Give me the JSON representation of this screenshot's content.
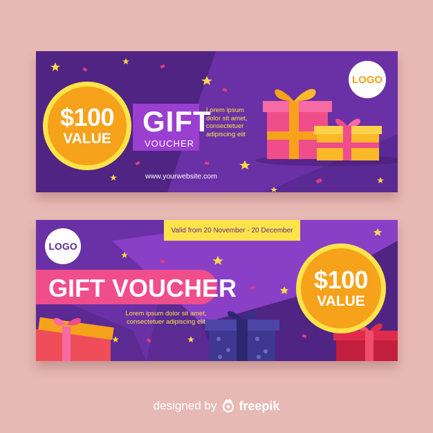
{
  "voucher_top": {
    "amount": "$100",
    "value_label": "VALUE",
    "title": "GIFT",
    "subtitle": "VOUCHER",
    "lorem_lines": [
      "Lorem ipsum",
      "dolor sit amet,",
      "consectetuer",
      "adipiscing elit"
    ],
    "website": "www.yourwebsite.com",
    "logo": "LOGO"
  },
  "voucher_bottom": {
    "logo": "LOGO",
    "valid": "Valid from 20 November - 20 December",
    "title": "GIFT VOUCHER",
    "lorem_lines": [
      "Lorem ipsum dolor sit amet,",
      "consectetuer adipiscing elit"
    ],
    "amount": "$100",
    "value_label": "VALUE"
  },
  "credit": {
    "designed": "designed by",
    "brand": "freepik"
  },
  "colors": {
    "background": "#e7b9b4",
    "voucher_purple": "#5b2a92",
    "accent_orange": "#f6a21a",
    "accent_yellow": "#fde34a",
    "accent_pink": "#f04d8b"
  }
}
